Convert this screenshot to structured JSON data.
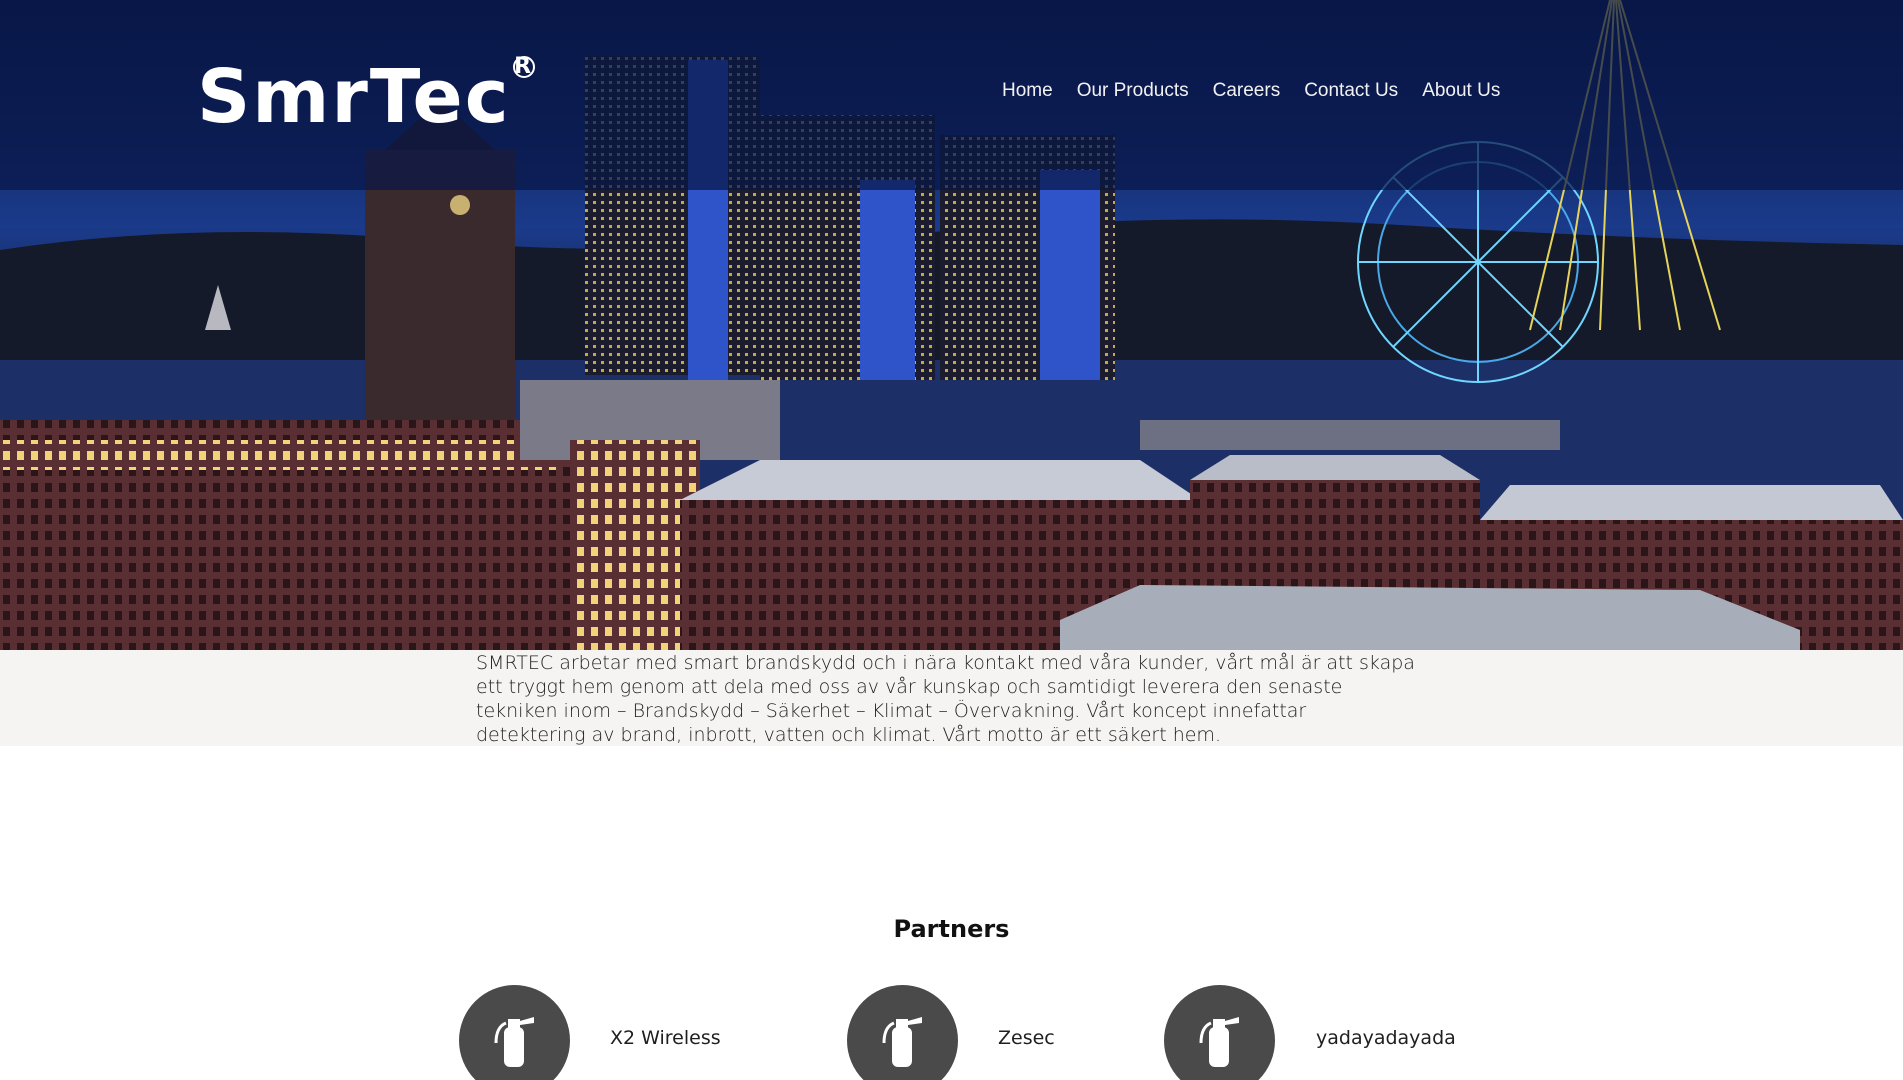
{
  "header": {
    "logo_main": "SmrTec",
    "logo_reg": "R",
    "nav": [
      "Home",
      "Our Products",
      "Careers",
      "Contact Us",
      "About Us"
    ]
  },
  "intro": {
    "text": "SMRTEC arbetar med smart brandskydd och i nära kontakt med våra kunder, vårt mål är att skapa ett tryggt hem genom att dela med oss av vår kunskap och samtidigt leverera den senaste tekniken inom – Brandskydd – Säkerhet – Klimat – Övervakning. Vårt koncept innefattar detektering av brand, inbrott, vatten och klimat. Vårt motto är ett säkert hem."
  },
  "partners": {
    "title": "Partners",
    "items": [
      {
        "name": "X2 Wireless",
        "icon": "fire-extinguisher-icon"
      },
      {
        "name": "Zesec",
        "icon": "fire-extinguisher-icon"
      },
      {
        "name": "yadayadayada",
        "icon": "fire-extinguisher-icon"
      }
    ]
  },
  "colors": {
    "header_overlay": "#081646",
    "partner_circle": "#4a4a4a",
    "intro_band": "#f6f4f3"
  }
}
